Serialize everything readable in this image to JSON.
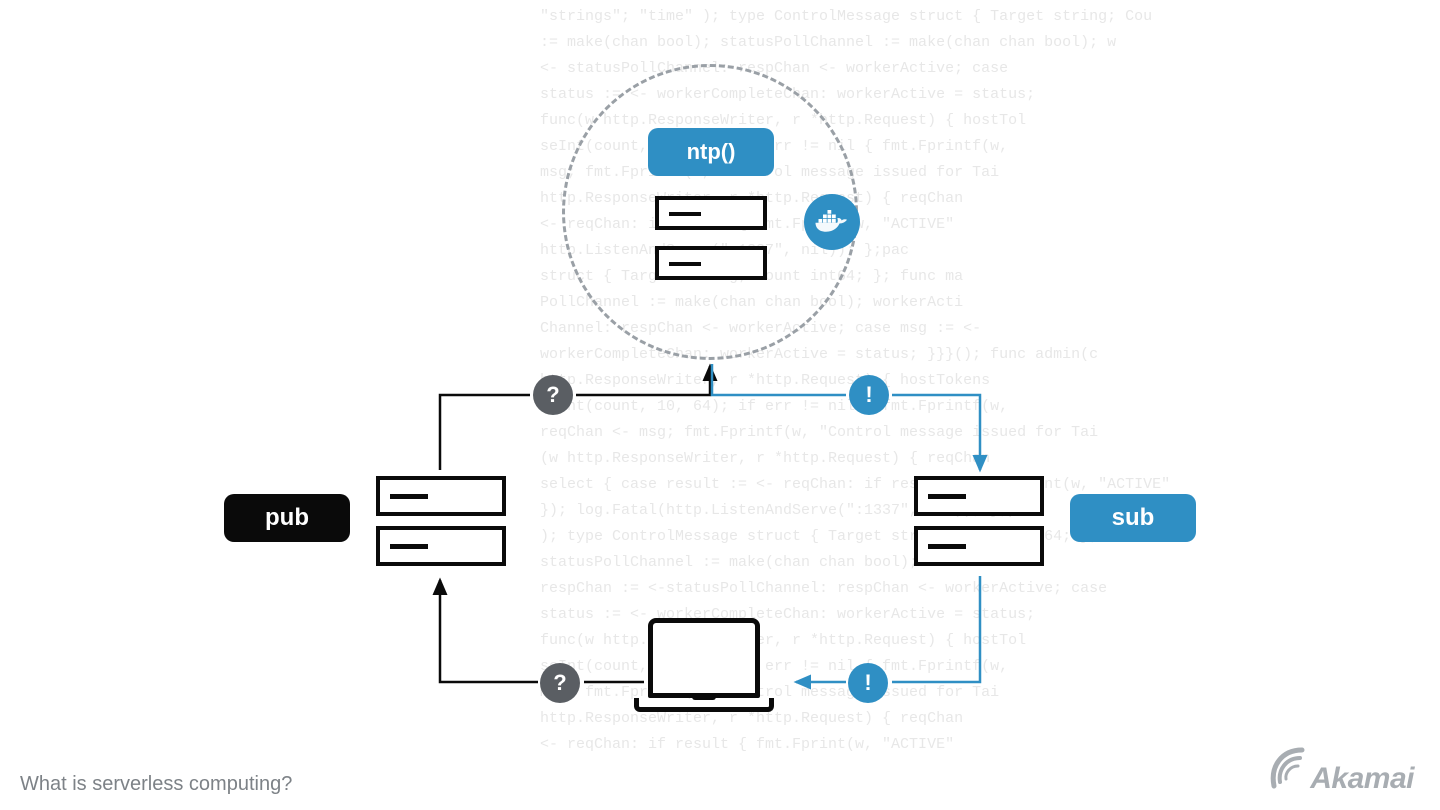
{
  "caption": "What is serverless computing?",
  "brand": "Akamai",
  "ntp_label": "ntp()",
  "pub_label": "pub",
  "sub_label": "sub",
  "icons": {
    "question": "?",
    "exclaim": "!"
  },
  "colors": {
    "akamai_blue": "#2f8fc4",
    "dark": "#0a0a0a",
    "gray_icon": "#5a5e63",
    "dash": "#9aa0a6"
  },
  "background_code": "\"strings\"; \"time\" ); type ControlMessage struct { Target string; Cou\n:= make(chan bool); statusPollChannel := make(chan chan bool); w\n<- statusPollChannel: respChan <- workerActive; case \nstatus := <- workerCompleteChan: workerActive = status; \nfunc(w http.ResponseWriter, r *http.Request) { hostTol\nseInt(count, 10, 64); if err != nil { fmt.Fprintf(w, \nmsg; fmt.Fprintf(w, \"Control message issued for Tai\nhttp.ResponseWriter, r *http.Request) { reqChan \n<- reqChan: if result { fmt.Fprint(w, \"ACTIVE\" \nhttp.ListenAndServe(\":1337\", nil)); };pac\nstruct { Target string; Count int64; }; func ma\nPollChannel := make(chan chan bool); workerActi\nChannel: respChan <- workerActive; case msg := <-\nworkerCompleteChan: workerActive = status; }}}(); func admin(c\nhttp.ResponseWriter, r *http.Request) { hostTokens \nseInt(count, 10, 64); if err != nil { fmt.Fprintf(w, \nreqChan <- msg; fmt.Fprintf(w, \"Control message issued for Tai\n(w http.ResponseWriter, r *http.Request) { reqChan \nselect { case result := <- reqChan: if result { fmt.Fprint(w, \"ACTIVE\" \n}); log.Fatal(http.ListenAndServe(\":1337\", nil)); };pac\n); type ControlMessage struct { Target string; Count int64; }; func ma\nstatusPollChannel := make(chan chan bool); workerActi\nrespChan := <-statusPollChannel: respChan <- workerActive; case \nstatus := <- workerCompleteChan: workerActive = status; \nfunc(w http.ResponseWriter, r *http.Request) { hostTol\nseInt(count, 10, 64); if err != nil { fmt.Fprintf(w, \nmsg; fmt.Fprintf(w, \"Control message issued for Tai\nhttp.ResponseWriter, r *http.Request) { reqChan \n<- reqChan: if result { fmt.Fprint(w, \"ACTIVE\""
}
